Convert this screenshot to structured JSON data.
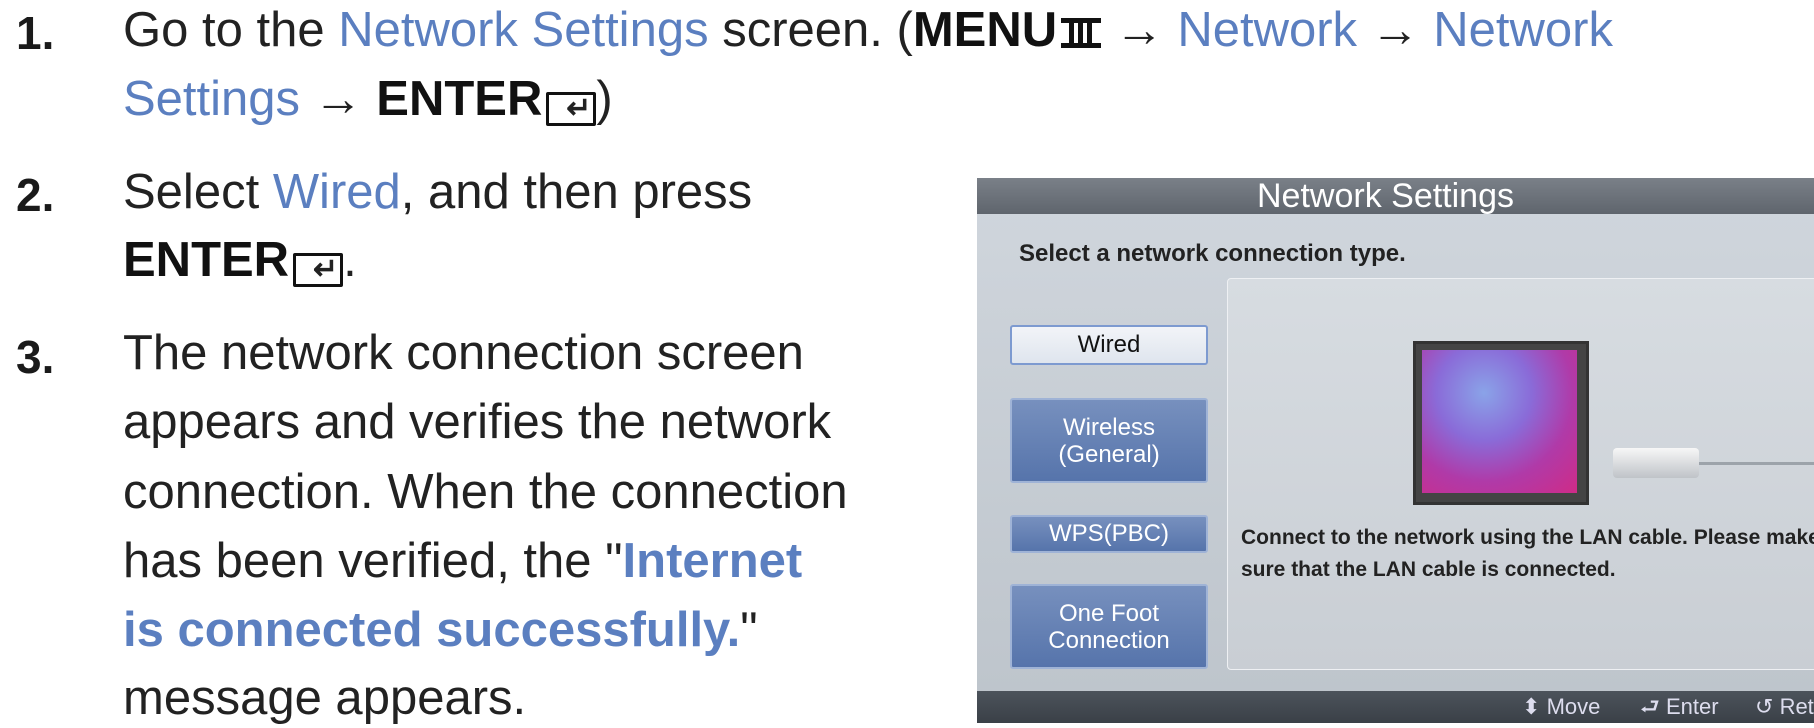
{
  "steps": [
    {
      "number": "1.",
      "line1": {
        "pre": "Go to the ",
        "link1": "Network Settings",
        "mid": " screen. (",
        "menu": "MENU",
        "arrow1": " → ",
        "link2": "Network",
        "arrow2": " → ",
        "link3": "Network"
      },
      "line2": {
        "link": "Settings",
        "arrow": " → ",
        "enter": "ENTER",
        "close": ")"
      }
    },
    {
      "number": "2.",
      "line1": {
        "pre": "Select ",
        "link": "Wired",
        "post": ", and then press"
      },
      "line2": {
        "enter": "ENTER",
        "post": "."
      }
    },
    {
      "number": "3.",
      "lines": [
        "The network connection screen",
        "appears and verifies the network",
        "connection. When the connection"
      ],
      "line4": {
        "pre": "has been verified, the \"",
        "link": "Internet"
      },
      "line5": {
        "link": "is connected successfully.",
        "post": "\""
      },
      "line6": "message appears."
    }
  ],
  "tv": {
    "title": "Network Settings",
    "subtitle": "Select a network connection type.",
    "buttons": [
      {
        "label": "Wired",
        "selected": true
      },
      {
        "label": "Wireless\n(General)",
        "selected": false
      },
      {
        "label": "WPS(PBC)",
        "selected": false
      },
      {
        "label": "One Foot\nConnection",
        "selected": false
      }
    ],
    "message_line1": "Connect to the network using the LAN cable. Please make",
    "message_line2": "sure that the LAN cable is connected.",
    "footer": {
      "move": "Move",
      "enter": "Enter",
      "return": "Return"
    }
  }
}
